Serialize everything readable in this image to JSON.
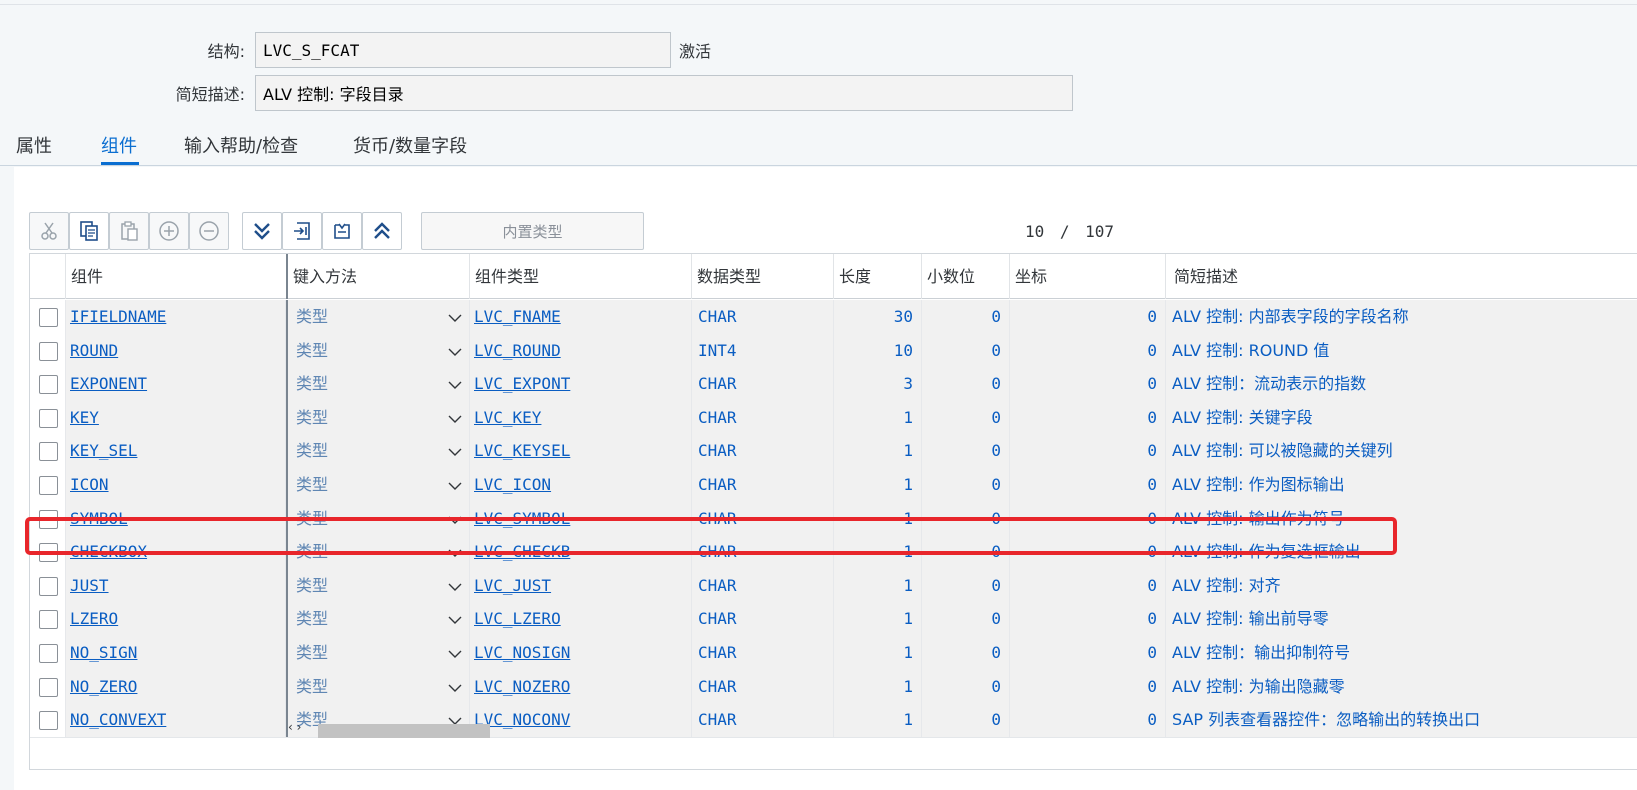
{
  "header": {
    "structure_label": "结构:",
    "structure_value": "LVC_S_FCAT",
    "structure_status": "激活",
    "desc_label": "简短描述:",
    "desc_value": "ALV 控制: 字段目录"
  },
  "tabs": [
    {
      "label": "属性",
      "active": false
    },
    {
      "label": "组件",
      "active": true
    },
    {
      "label": "输入帮助/检查",
      "active": false
    },
    {
      "label": "货币/数量字段",
      "active": false
    }
  ],
  "toolbar": {
    "buttons": [
      {
        "icon": "cut-icon",
        "enabled": false
      },
      {
        "icon": "copy-icon",
        "enabled": true
      },
      {
        "icon": "paste-icon",
        "enabled": false
      },
      {
        "icon": "add-row-icon",
        "enabled": false
      },
      {
        "icon": "remove-row-icon",
        "enabled": false
      },
      {
        "icon": "expand-all-icon",
        "enabled": true
      },
      {
        "icon": "insert-row-icon",
        "enabled": true
      },
      {
        "icon": "select-block-icon",
        "enabled": true
      },
      {
        "icon": "collapse-all-icon",
        "enabled": true
      }
    ],
    "type_placeholder": "内置类型",
    "counter": "10 / 107"
  },
  "columns": [
    "组件",
    "键入方法",
    "组件类型",
    "数据类型",
    "长度",
    "小数位",
    "坐标",
    "简短描述"
  ],
  "rows": [
    {
      "component": "IFIELDNAME",
      "keyin": "类型",
      "ctype": "LVC_FNAME",
      "dtype": "CHAR",
      "length": "30",
      "decimals": "0",
      "coord": "0",
      "desc": "ALV 控制: 内部表字段的字段名称"
    },
    {
      "component": "ROUND",
      "keyin": "类型",
      "ctype": "LVC_ROUND",
      "dtype": "INT4",
      "length": "10",
      "decimals": "0",
      "coord": "0",
      "desc": "ALV 控制: ROUND 值"
    },
    {
      "component": "EXPONENT",
      "keyin": "类型",
      "ctype": "LVC_EXPONT",
      "dtype": "CHAR",
      "length": "3",
      "decimals": "0",
      "coord": "0",
      "desc": "ALV 控制：流动表示的指数"
    },
    {
      "component": "KEY",
      "keyin": "类型",
      "ctype": "LVC_KEY",
      "dtype": "CHAR",
      "length": "1",
      "decimals": "0",
      "coord": "0",
      "desc": "ALV 控制: 关键字段"
    },
    {
      "component": "KEY_SEL",
      "keyin": "类型",
      "ctype": "LVC_KEYSEL",
      "dtype": "CHAR",
      "length": "1",
      "decimals": "0",
      "coord": "0",
      "desc": "ALV 控制: 可以被隐藏的关键列"
    },
    {
      "component": "ICON",
      "keyin": "类型",
      "ctype": "LVC_ICON",
      "dtype": "CHAR",
      "length": "1",
      "decimals": "0",
      "coord": "0",
      "desc": "ALV 控制: 作为图标输出"
    },
    {
      "component": "SYMBOL",
      "keyin": "类型",
      "ctype": "LVC_SYMBOL",
      "dtype": "CHAR",
      "length": "1",
      "decimals": "0",
      "coord": "0",
      "desc": "ALV 控制: 输出作为符号"
    },
    {
      "component": "CHECKBOX",
      "keyin": "类型",
      "ctype": "LVC_CHECKB",
      "dtype": "CHAR",
      "length": "1",
      "decimals": "0",
      "coord": "0",
      "desc": "ALV 控制: 作为复选框输出"
    },
    {
      "component": "JUST",
      "keyin": "类型",
      "ctype": "LVC_JUST",
      "dtype": "CHAR",
      "length": "1",
      "decimals": "0",
      "coord": "0",
      "desc": "ALV 控制: 对齐"
    },
    {
      "component": "LZERO",
      "keyin": "类型",
      "ctype": "LVC_LZERO",
      "dtype": "CHAR",
      "length": "1",
      "decimals": "0",
      "coord": "0",
      "desc": "ALV 控制: 输出前导零"
    },
    {
      "component": "NO_SIGN",
      "keyin": "类型",
      "ctype": "LVC_NOSIGN",
      "dtype": "CHAR",
      "length": "1",
      "decimals": "0",
      "coord": "0",
      "desc": "ALV 控制：输出抑制符号"
    },
    {
      "component": "NO_ZERO",
      "keyin": "类型",
      "ctype": "LVC_NOZERO",
      "dtype": "CHAR",
      "length": "1",
      "decimals": "0",
      "coord": "0",
      "desc": "ALV 控制: 为输出隐藏零"
    },
    {
      "component": "NO_CONVEXT",
      "keyin": "类型",
      "ctype": "LVC_NOCONV",
      "dtype": "CHAR",
      "length": "1",
      "decimals": "0",
      "coord": "0",
      "desc": "SAP 列表查看器控件：忽略输出的转换出口"
    }
  ],
  "highlighted_row": "CHECKBOX",
  "colors": {
    "accent": "#0a6ed1",
    "link": "#0a5dc2",
    "highlight_frame": "#e8262b"
  }
}
